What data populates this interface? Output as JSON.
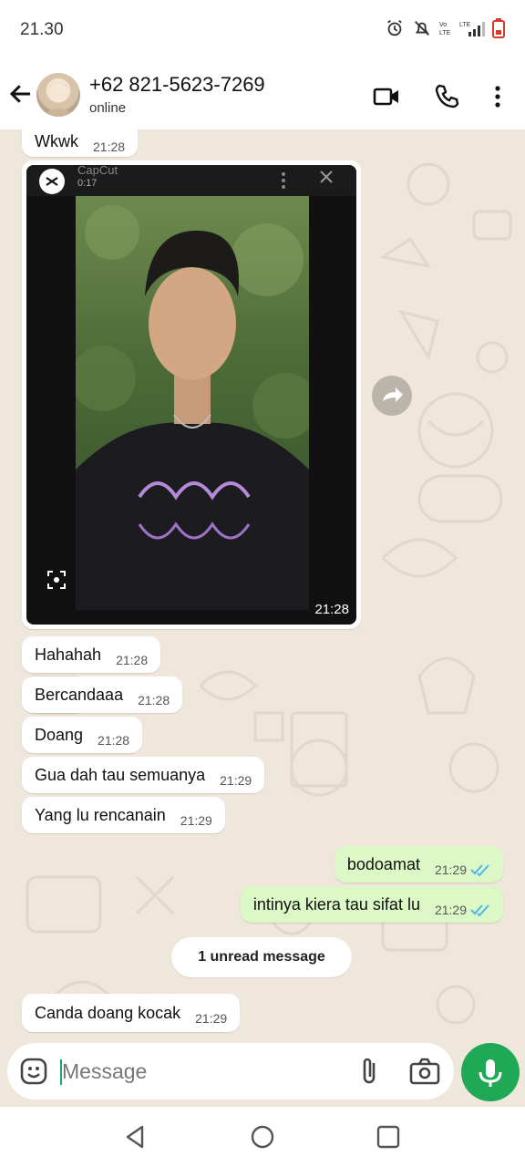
{
  "status_bar": {
    "time": "21.30",
    "icons": [
      "alarm-icon",
      "mute-icon",
      "volte-icon",
      "lte-signal-icon",
      "battery-low-icon"
    ]
  },
  "header": {
    "title": "+62 821-5623-7269",
    "subtitle": "online",
    "icons": [
      "back-arrow-icon",
      "video-call-icon",
      "voice-call-icon",
      "more-vert-icon"
    ]
  },
  "messages": [
    {
      "dir": "in",
      "text": "Wkwk",
      "time": "21:28"
    },
    {
      "dir": "in",
      "type": "media",
      "app_name": "CapCut",
      "duration": "0:17",
      "time": "21:28"
    },
    {
      "dir": "in",
      "text": "Hahahah",
      "time": "21:28"
    },
    {
      "dir": "in",
      "text": "Bercandaaa",
      "time": "21:28"
    },
    {
      "dir": "in",
      "text": "Doang",
      "time": "21:28"
    },
    {
      "dir": "in",
      "text": "Gua dah tau semuanya",
      "time": "21:29"
    },
    {
      "dir": "in",
      "text": "Yang lu rencanain",
      "time": "21:29"
    },
    {
      "dir": "out",
      "text": "bodoamat",
      "time": "21:29",
      "status": "read"
    },
    {
      "dir": "out",
      "text": "intinya kiera tau sifat lu",
      "time": "21:29",
      "status": "read"
    },
    {
      "dir": "in",
      "text": "Canda doang kocak",
      "time": "21:29"
    }
  ],
  "unread_banner": "1 unread message",
  "composer": {
    "placeholder": "Message",
    "value": ""
  },
  "colors": {
    "accent_green": "#1fa855",
    "outgoing_bubble": "#dcf8c6",
    "read_ticks": "#4fb6ec",
    "chat_bg": "#efe7dc"
  }
}
